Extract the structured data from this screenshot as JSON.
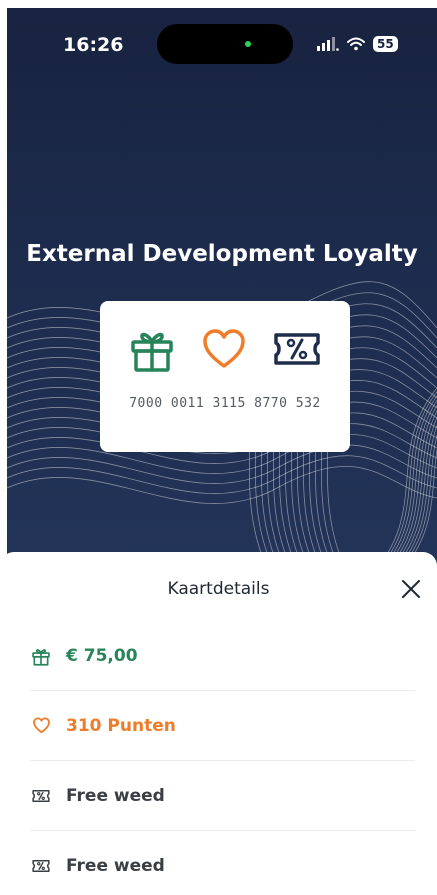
{
  "status_bar": {
    "time": "16:26",
    "battery": "55"
  },
  "program": {
    "title": "External Development Loyalty"
  },
  "card": {
    "number": "7000 0011 3115 8770 532",
    "icons": [
      "gift-icon",
      "heart-icon",
      "discount-ticket-icon"
    ]
  },
  "sheet": {
    "title": "Kaartdetails",
    "rows": [
      {
        "icon": "gift-icon",
        "text": "€ 75,00"
      },
      {
        "icon": "heart-icon",
        "text": "310 Punten"
      },
      {
        "icon": "discount-ticket-icon",
        "text": "Free weed"
      },
      {
        "icon": "discount-ticket-icon",
        "text": "Free weed"
      }
    ]
  },
  "colors": {
    "hero_background": "#1d2b4d",
    "gift_green": "#27845a",
    "points_orange": "#f07c2a",
    "ticket_navy": "#1f2d4d"
  }
}
